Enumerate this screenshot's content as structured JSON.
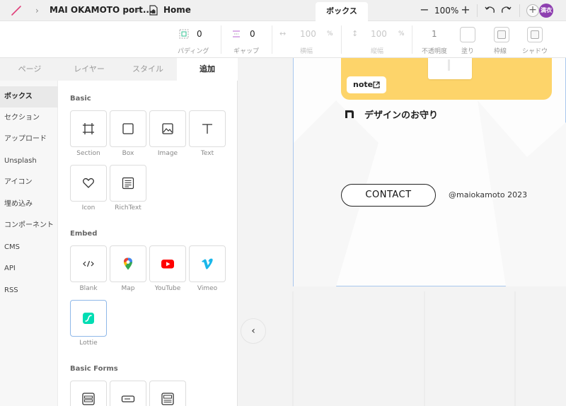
{
  "topbar": {
    "project_name": "MAI OKAMOTO port...",
    "page_name": "Home",
    "active_tab": "ボックス",
    "zoom_level": "100%",
    "zoom_out": "−",
    "zoom_in": "+",
    "add_collaborator": "+",
    "avatar_text": "満衣"
  },
  "properties": {
    "padding": {
      "value": "0",
      "label": "パディング"
    },
    "gap": {
      "value": "0",
      "label": "ギャップ"
    },
    "width": {
      "value": "100",
      "unit": "%",
      "label": "横幅"
    },
    "height": {
      "value": "100",
      "unit": "%",
      "label": "縦幅"
    },
    "opacity": {
      "value": "1",
      "label": "不透明度"
    },
    "fill": {
      "label": "塗り"
    },
    "border": {
      "label": "枠線"
    },
    "shadow": {
      "label": "シャドウ"
    }
  },
  "panel": {
    "tabs": [
      "ページ",
      "レイヤー",
      "スタイル",
      "追加"
    ],
    "active_tab_index": 3,
    "categories": [
      "ボックス",
      "セクション",
      "アップロード",
      "Unsplash",
      "アイコン",
      "埋め込み",
      "コンポーネント",
      "CMS",
      "API",
      "RSS"
    ],
    "active_category_index": 0,
    "sections": {
      "basic": {
        "title": "Basic",
        "items": [
          "Section",
          "Box",
          "Image",
          "Text",
          "Icon",
          "RichText"
        ]
      },
      "embed": {
        "title": "Embed",
        "items": [
          "Blank",
          "Map",
          "YouTube",
          "Vimeo",
          "Lottie"
        ]
      },
      "basic_forms": {
        "title": "Basic Forms"
      }
    },
    "collapse_icon": "‹"
  },
  "canvas": {
    "note_badge": "note",
    "note_title": "デザインのお守り",
    "contact_button": "CONTACT",
    "copyright": "@maiokamoto 2023"
  },
  "colors": {
    "accent_yellow": "#fdd46a",
    "avatar_purple": "#8e3fb0",
    "selection_blue": "#a9c7ee",
    "youtube_red": "#ff0000",
    "vimeo_blue": "#1ab7ea",
    "lottie_teal": "#00ddb3"
  }
}
